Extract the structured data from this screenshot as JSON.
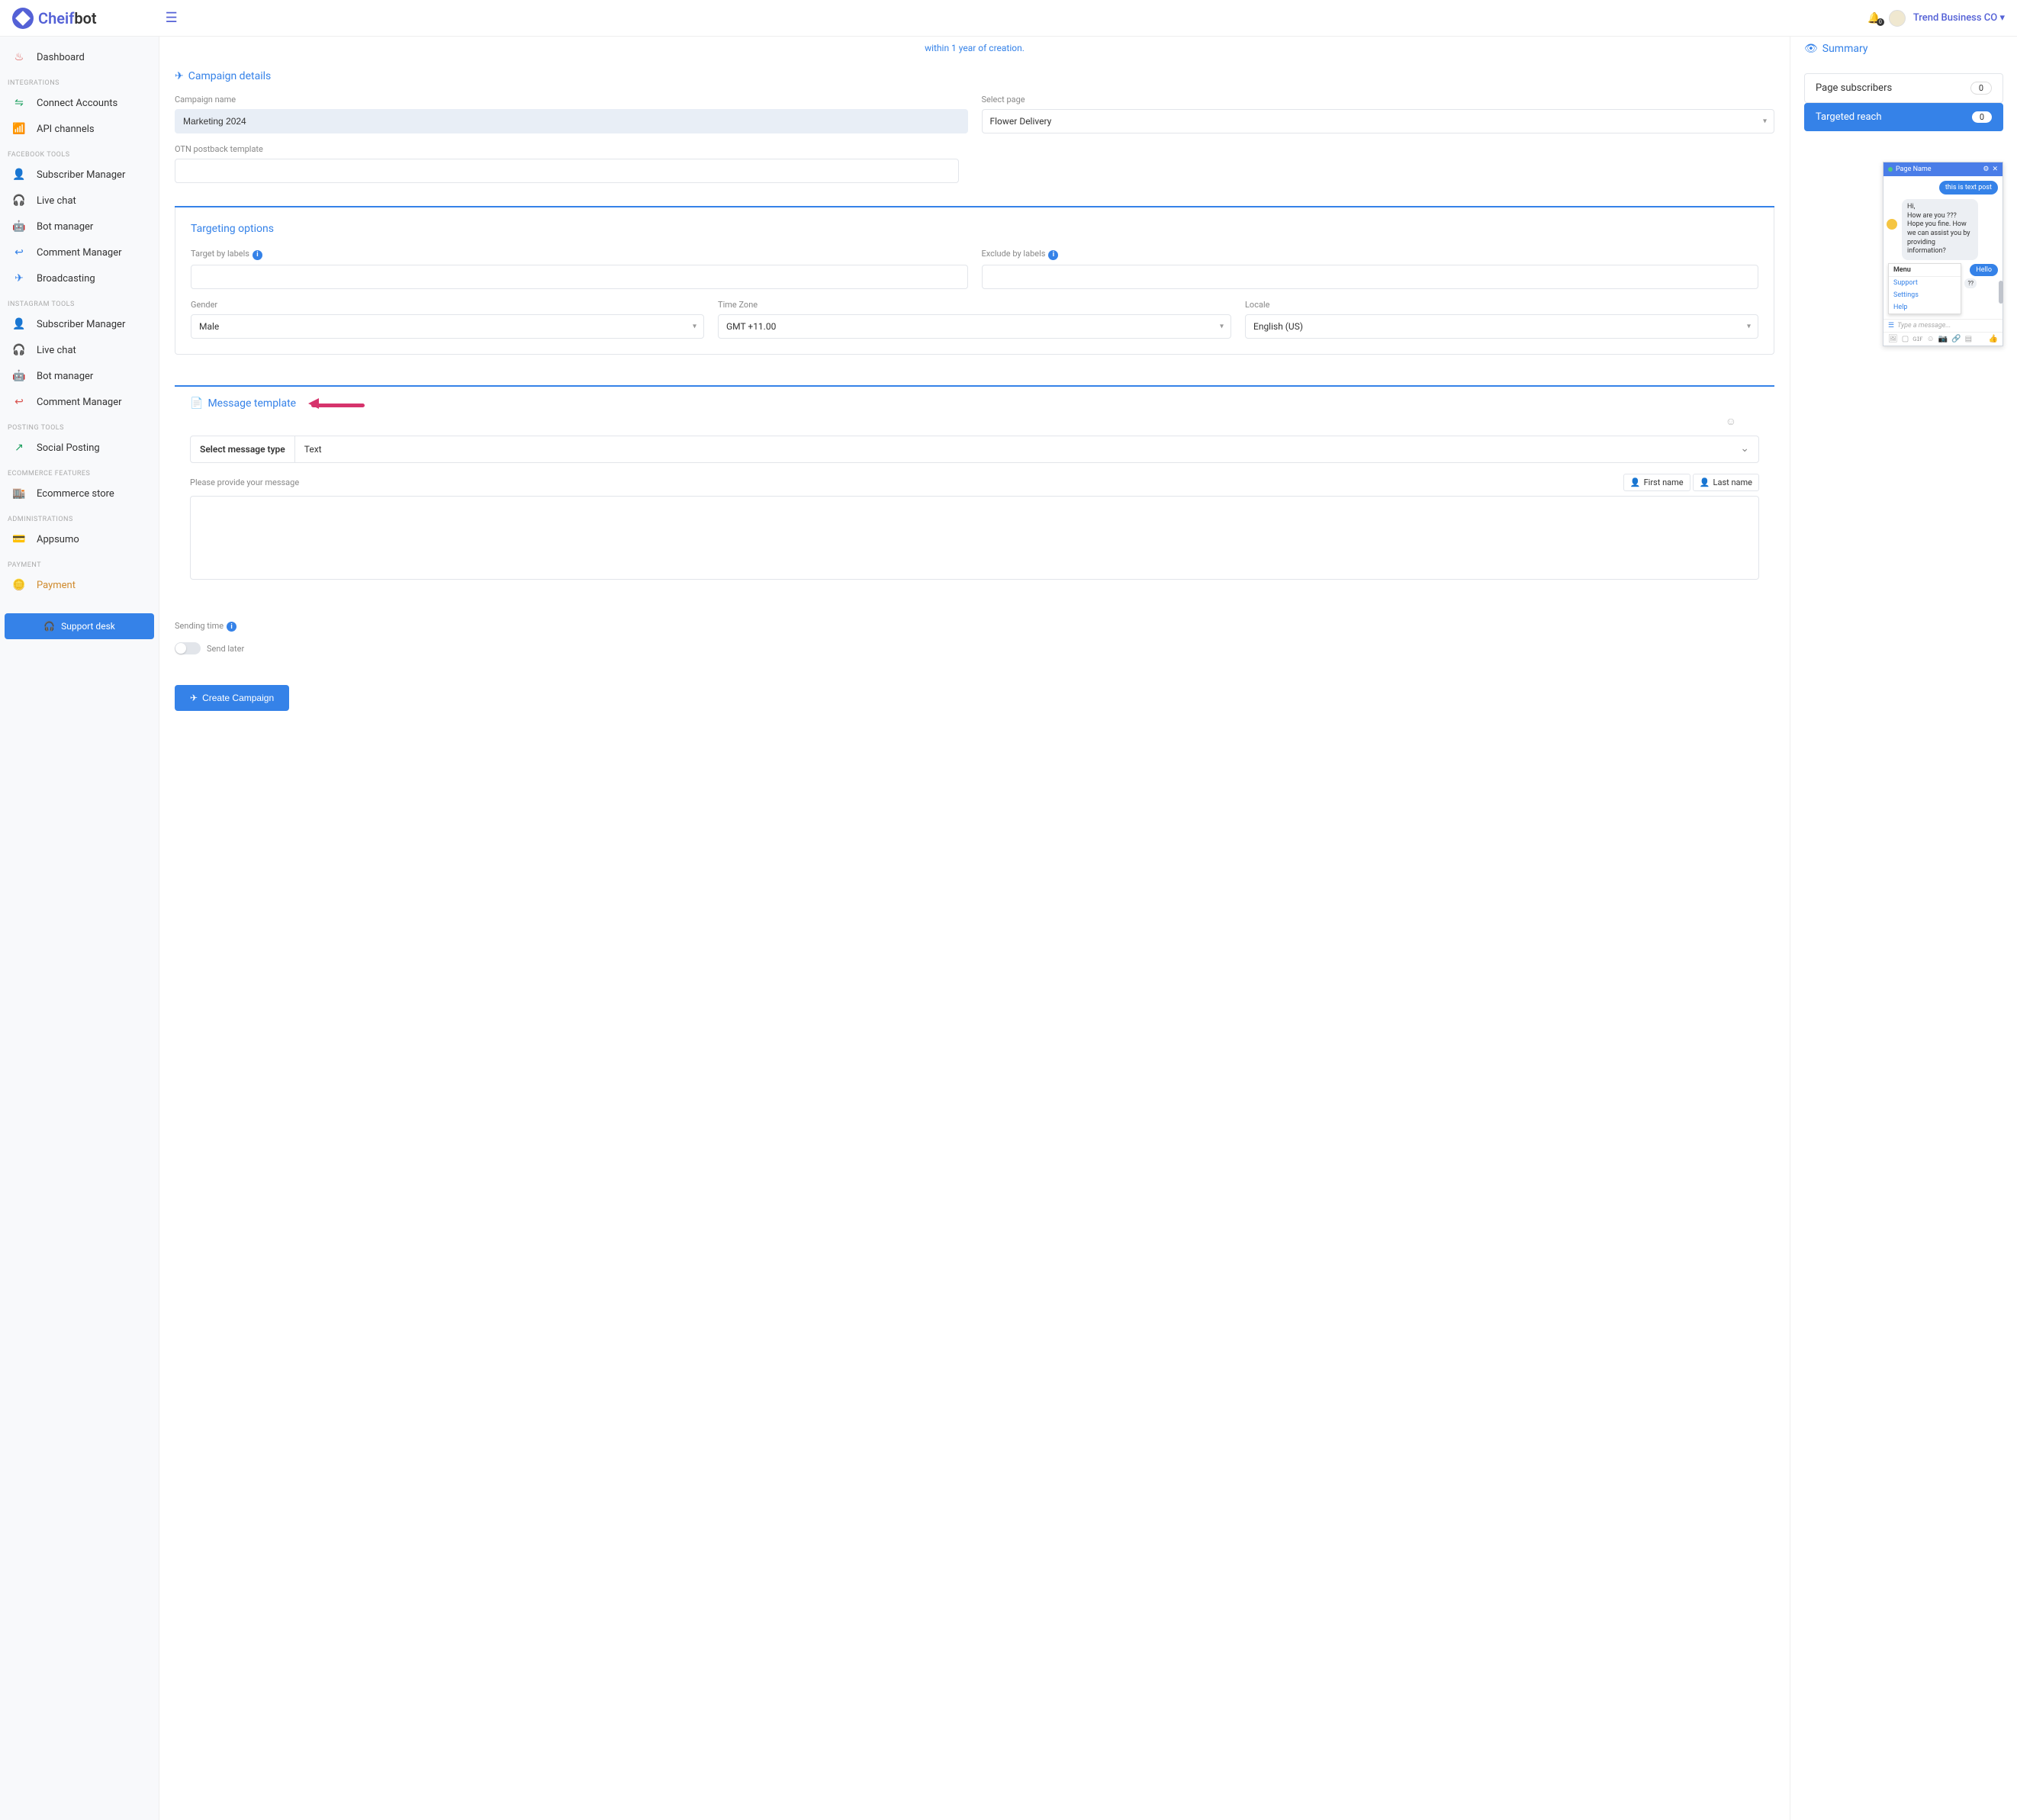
{
  "header": {
    "brand_a": "Cheif",
    "brand_b": "bot",
    "company": "Trend Business CO",
    "bell_count": "0"
  },
  "sidebar": {
    "dashboard": "Dashboard",
    "sec_integrations": "INTEGRATIONS",
    "connect_accounts": "Connect Accounts",
    "api_channels": "API channels",
    "sec_fb": "FACEBOOK TOOLS",
    "fb_sub": "Subscriber Manager",
    "fb_chat": "Live chat",
    "fb_bot": "Bot manager",
    "fb_comment": "Comment Manager",
    "fb_broadcast": "Broadcasting",
    "sec_ig": "INSTAGRAM TOOLS",
    "ig_sub": "Subscriber Manager",
    "ig_chat": "Live chat",
    "ig_bot": "Bot manager",
    "ig_comment": "Comment Manager",
    "sec_posting": "POSTING TOOLS",
    "social_posting": "Social Posting",
    "sec_ecom": "ECOMMERCE FEATURES",
    "ecom": "Ecommerce store",
    "sec_admin": "ADMINISTRATIONS",
    "appsumo": "Appsumo",
    "sec_payment": "PAYMENT",
    "payment": "Payment",
    "support_desk": "Support desk"
  },
  "form": {
    "notice": "within 1 year of creation.",
    "campaign_details": "Campaign details",
    "campaign_name_label": "Campaign name",
    "campaign_name_value": "Marketing 2024",
    "select_page_label": "Select page",
    "select_page_value": "Flower Delivery",
    "otn_label": "OTN postback template",
    "targeting_title": "Targeting options",
    "target_labels": "Target by labels",
    "exclude_labels": "Exclude by labels",
    "gender_label": "Gender",
    "gender_value": "Male",
    "tz_label": "Time Zone",
    "tz_value": "GMT +11.00",
    "locale_label": "Locale",
    "locale_value": "English (US)",
    "msg_template": "Message template",
    "select_msg_type": "Select message type",
    "msg_type_value": "Text",
    "provide_msg": "Please provide your message",
    "first_name": "First name",
    "last_name": "Last name",
    "sending_time": "Sending time",
    "send_later": "Send later",
    "create_campaign": "Create Campaign"
  },
  "summary": {
    "title": "Summary",
    "page_subs": "Page subscribers",
    "page_subs_count": "0",
    "targeted": "Targeted reach",
    "targeted_count": "0"
  },
  "chat": {
    "page_name": "Page Name",
    "text_post": "this is text post",
    "greeting": "Hi,\nHow are you  ??? Hope you fine. How we can assist you by providing information?",
    "menu": "Menu",
    "support": "Support",
    "settings": "Settings",
    "help": "Help",
    "hello": "Hello",
    "qq": "??",
    "placeholder": "Type a message..."
  }
}
